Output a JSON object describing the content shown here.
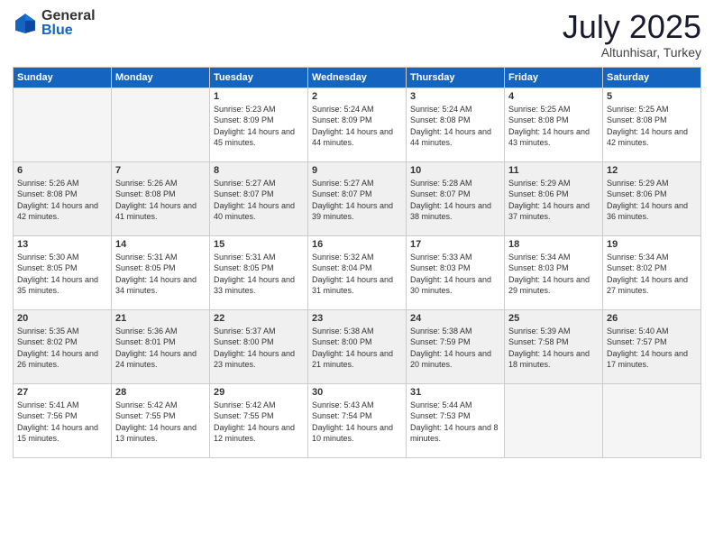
{
  "logo": {
    "general": "General",
    "blue": "Blue"
  },
  "header": {
    "month": "July 2025",
    "location": "Altunhisar, Turkey"
  },
  "weekdays": [
    "Sunday",
    "Monday",
    "Tuesday",
    "Wednesday",
    "Thursday",
    "Friday",
    "Saturday"
  ],
  "weeks": [
    [
      {
        "day": "",
        "empty": true
      },
      {
        "day": "",
        "empty": true
      },
      {
        "day": "1",
        "sunrise": "Sunrise: 5:23 AM",
        "sunset": "Sunset: 8:09 PM",
        "daylight": "Daylight: 14 hours and 45 minutes."
      },
      {
        "day": "2",
        "sunrise": "Sunrise: 5:24 AM",
        "sunset": "Sunset: 8:09 PM",
        "daylight": "Daylight: 14 hours and 44 minutes."
      },
      {
        "day": "3",
        "sunrise": "Sunrise: 5:24 AM",
        "sunset": "Sunset: 8:08 PM",
        "daylight": "Daylight: 14 hours and 44 minutes."
      },
      {
        "day": "4",
        "sunrise": "Sunrise: 5:25 AM",
        "sunset": "Sunset: 8:08 PM",
        "daylight": "Daylight: 14 hours and 43 minutes."
      },
      {
        "day": "5",
        "sunrise": "Sunrise: 5:25 AM",
        "sunset": "Sunset: 8:08 PM",
        "daylight": "Daylight: 14 hours and 42 minutes."
      }
    ],
    [
      {
        "day": "6",
        "sunrise": "Sunrise: 5:26 AM",
        "sunset": "Sunset: 8:08 PM",
        "daylight": "Daylight: 14 hours and 42 minutes."
      },
      {
        "day": "7",
        "sunrise": "Sunrise: 5:26 AM",
        "sunset": "Sunset: 8:08 PM",
        "daylight": "Daylight: 14 hours and 41 minutes."
      },
      {
        "day": "8",
        "sunrise": "Sunrise: 5:27 AM",
        "sunset": "Sunset: 8:07 PM",
        "daylight": "Daylight: 14 hours and 40 minutes."
      },
      {
        "day": "9",
        "sunrise": "Sunrise: 5:27 AM",
        "sunset": "Sunset: 8:07 PM",
        "daylight": "Daylight: 14 hours and 39 minutes."
      },
      {
        "day": "10",
        "sunrise": "Sunrise: 5:28 AM",
        "sunset": "Sunset: 8:07 PM",
        "daylight": "Daylight: 14 hours and 38 minutes."
      },
      {
        "day": "11",
        "sunrise": "Sunrise: 5:29 AM",
        "sunset": "Sunset: 8:06 PM",
        "daylight": "Daylight: 14 hours and 37 minutes."
      },
      {
        "day": "12",
        "sunrise": "Sunrise: 5:29 AM",
        "sunset": "Sunset: 8:06 PM",
        "daylight": "Daylight: 14 hours and 36 minutes."
      }
    ],
    [
      {
        "day": "13",
        "sunrise": "Sunrise: 5:30 AM",
        "sunset": "Sunset: 8:05 PM",
        "daylight": "Daylight: 14 hours and 35 minutes."
      },
      {
        "day": "14",
        "sunrise": "Sunrise: 5:31 AM",
        "sunset": "Sunset: 8:05 PM",
        "daylight": "Daylight: 14 hours and 34 minutes."
      },
      {
        "day": "15",
        "sunrise": "Sunrise: 5:31 AM",
        "sunset": "Sunset: 8:05 PM",
        "daylight": "Daylight: 14 hours and 33 minutes."
      },
      {
        "day": "16",
        "sunrise": "Sunrise: 5:32 AM",
        "sunset": "Sunset: 8:04 PM",
        "daylight": "Daylight: 14 hours and 31 minutes."
      },
      {
        "day": "17",
        "sunrise": "Sunrise: 5:33 AM",
        "sunset": "Sunset: 8:03 PM",
        "daylight": "Daylight: 14 hours and 30 minutes."
      },
      {
        "day": "18",
        "sunrise": "Sunrise: 5:34 AM",
        "sunset": "Sunset: 8:03 PM",
        "daylight": "Daylight: 14 hours and 29 minutes."
      },
      {
        "day": "19",
        "sunrise": "Sunrise: 5:34 AM",
        "sunset": "Sunset: 8:02 PM",
        "daylight": "Daylight: 14 hours and 27 minutes."
      }
    ],
    [
      {
        "day": "20",
        "sunrise": "Sunrise: 5:35 AM",
        "sunset": "Sunset: 8:02 PM",
        "daylight": "Daylight: 14 hours and 26 minutes."
      },
      {
        "day": "21",
        "sunrise": "Sunrise: 5:36 AM",
        "sunset": "Sunset: 8:01 PM",
        "daylight": "Daylight: 14 hours and 24 minutes."
      },
      {
        "day": "22",
        "sunrise": "Sunrise: 5:37 AM",
        "sunset": "Sunset: 8:00 PM",
        "daylight": "Daylight: 14 hours and 23 minutes."
      },
      {
        "day": "23",
        "sunrise": "Sunrise: 5:38 AM",
        "sunset": "Sunset: 8:00 PM",
        "daylight": "Daylight: 14 hours and 21 minutes."
      },
      {
        "day": "24",
        "sunrise": "Sunrise: 5:38 AM",
        "sunset": "Sunset: 7:59 PM",
        "daylight": "Daylight: 14 hours and 20 minutes."
      },
      {
        "day": "25",
        "sunrise": "Sunrise: 5:39 AM",
        "sunset": "Sunset: 7:58 PM",
        "daylight": "Daylight: 14 hours and 18 minutes."
      },
      {
        "day": "26",
        "sunrise": "Sunrise: 5:40 AM",
        "sunset": "Sunset: 7:57 PM",
        "daylight": "Daylight: 14 hours and 17 minutes."
      }
    ],
    [
      {
        "day": "27",
        "sunrise": "Sunrise: 5:41 AM",
        "sunset": "Sunset: 7:56 PM",
        "daylight": "Daylight: 14 hours and 15 minutes."
      },
      {
        "day": "28",
        "sunrise": "Sunrise: 5:42 AM",
        "sunset": "Sunset: 7:55 PM",
        "daylight": "Daylight: 14 hours and 13 minutes."
      },
      {
        "day": "29",
        "sunrise": "Sunrise: 5:42 AM",
        "sunset": "Sunset: 7:55 PM",
        "daylight": "Daylight: 14 hours and 12 minutes."
      },
      {
        "day": "30",
        "sunrise": "Sunrise: 5:43 AM",
        "sunset": "Sunset: 7:54 PM",
        "daylight": "Daylight: 14 hours and 10 minutes."
      },
      {
        "day": "31",
        "sunrise": "Sunrise: 5:44 AM",
        "sunset": "Sunset: 7:53 PM",
        "daylight": "Daylight: 14 hours and 8 minutes."
      },
      {
        "day": "",
        "empty": true
      },
      {
        "day": "",
        "empty": true
      }
    ]
  ]
}
